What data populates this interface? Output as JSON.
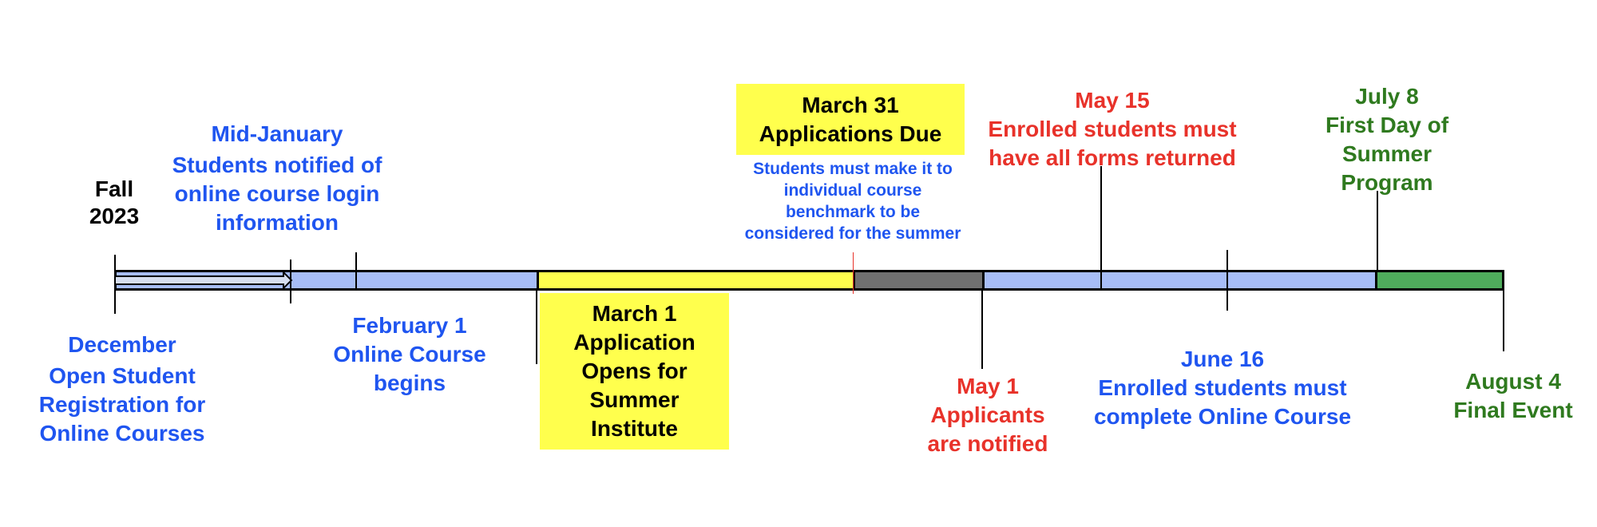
{
  "colors": {
    "blue_text": "#1f55f0",
    "red_text": "#e8322a",
    "green_text": "#2f7a1f",
    "bar_blue": "#a7bdf7",
    "bar_yellow": "#ffff4d",
    "bar_gray": "#707070",
    "bar_green": "#4fac5c",
    "highlight": "#ffff4d"
  },
  "events": {
    "fall": {
      "lines": [
        "Fall",
        "2023"
      ]
    },
    "mid_january": {
      "title": "Mid-January",
      "lines": [
        "Students notified of",
        "online course login",
        "information"
      ]
    },
    "december": {
      "title": "December",
      "lines": [
        "Open Student",
        "Registration for",
        "Online Courses"
      ]
    },
    "february": {
      "title": "February 1",
      "lines": [
        "Online Course",
        "begins"
      ]
    },
    "march1": {
      "title": "March 1",
      "lines": [
        "Application",
        "Opens for",
        "Summer",
        "Institute"
      ]
    },
    "march31": {
      "title": "March 31",
      "lines": [
        "Applications Due"
      ],
      "note": [
        "Students must make it to",
        "individual course",
        "benchmark to be",
        "considered for the summer"
      ]
    },
    "may15": {
      "title": "May 15",
      "lines": [
        "Enrolled students must",
        "have all forms returned"
      ]
    },
    "july8": {
      "title": "July 8",
      "lines": [
        "First Day of",
        "Summer",
        "Program"
      ]
    },
    "may1": {
      "title": "May 1",
      "lines": [
        "Applicants",
        "are notified"
      ]
    },
    "june16": {
      "title": "June 16",
      "lines": [
        "Enrolled students must",
        "complete Online Course"
      ]
    },
    "august4": {
      "title": "August 4",
      "lines": [
        "Final Event"
      ]
    }
  }
}
